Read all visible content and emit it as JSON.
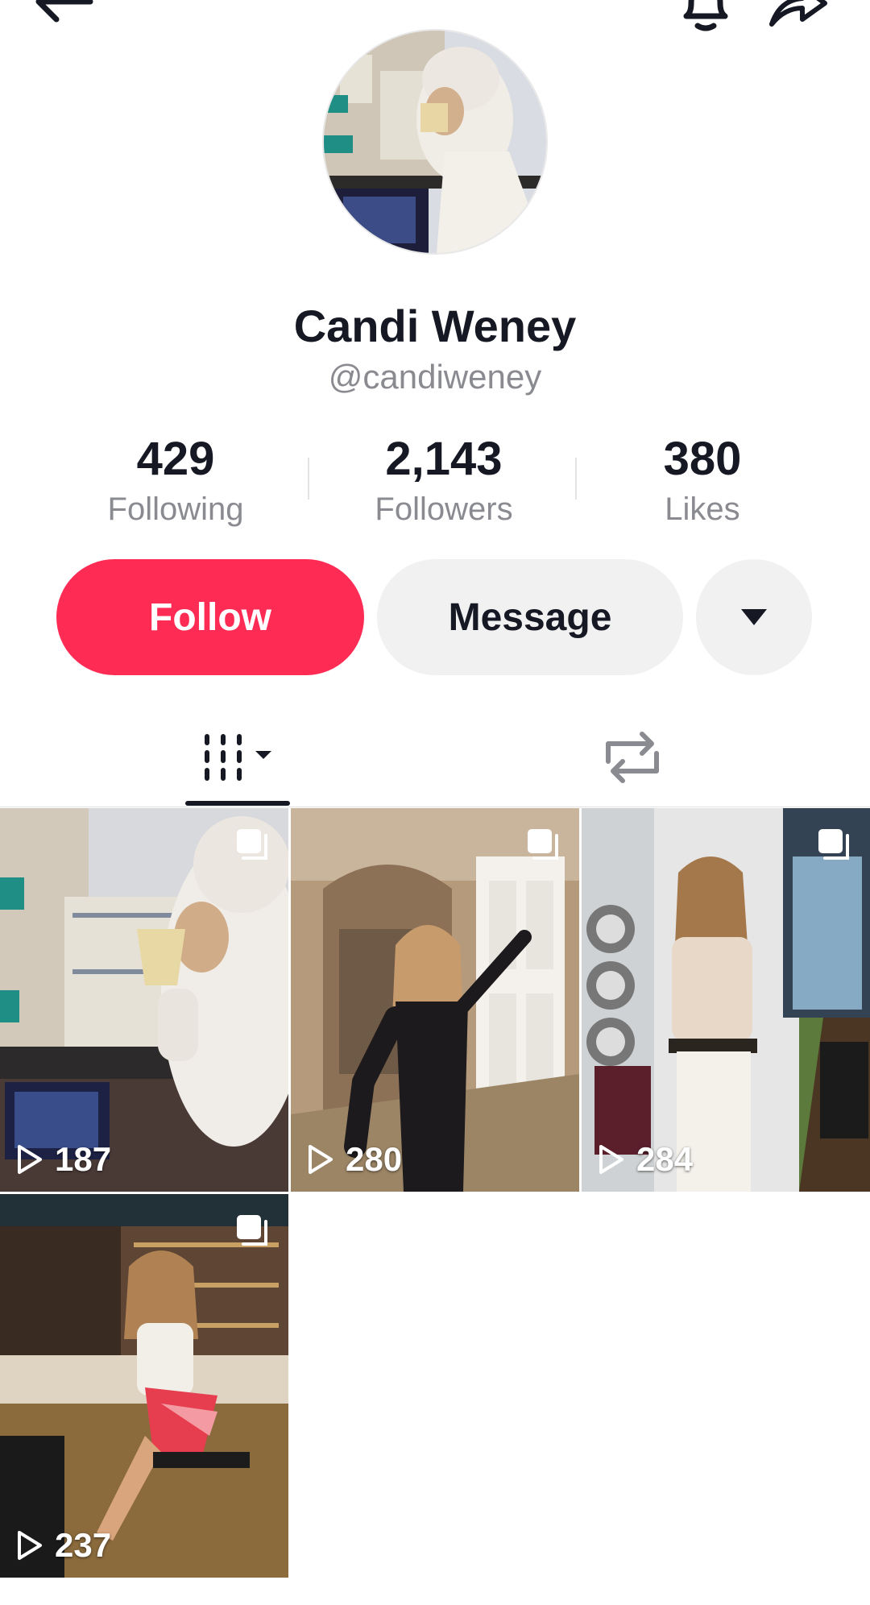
{
  "profile": {
    "name": "Candi Weney",
    "handle": "@candiweney"
  },
  "stats": [
    {
      "value": "429",
      "label": "Following"
    },
    {
      "value": "2,143",
      "label": "Followers"
    },
    {
      "value": "380",
      "label": "Likes"
    }
  ],
  "actions": {
    "follow_label": "Follow",
    "message_label": "Message"
  },
  "tabs": [
    {
      "icon": "videos-grid-icon",
      "selected": true
    },
    {
      "icon": "repost-icon",
      "selected": false
    }
  ],
  "videos": [
    {
      "views": "187"
    },
    {
      "views": "280"
    },
    {
      "views": "284"
    },
    {
      "views": "237"
    }
  ],
  "colors": {
    "accent": "#fe2c55",
    "secondary_button": "#f1f1f2",
    "muted_text": "#8a8b91",
    "primary_text": "#161823"
  }
}
